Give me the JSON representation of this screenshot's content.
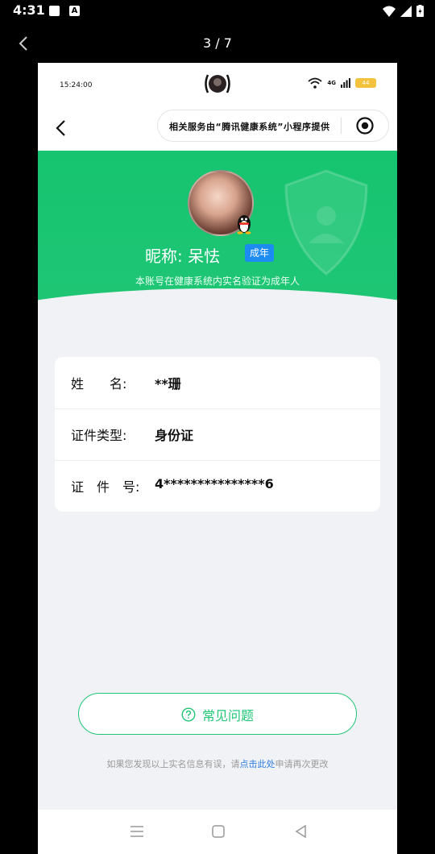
{
  "status_bar": {
    "time": "4:31",
    "icon_a": "A"
  },
  "gallery": {
    "page_counter": "3 / 7"
  },
  "inner": {
    "time": "15:24:00",
    "network": "4G",
    "battery": "44",
    "capsule_text": "相关服务由“腾讯健康系统”小程序提供"
  },
  "profile": {
    "nickname": "昵称:  呆怯",
    "age_tag": "成年",
    "verify_note": "本账号在健康系统内实名验证为成年人"
  },
  "info": {
    "rows": [
      {
        "label": "姓　　名:",
        "value": "**珊"
      },
      {
        "label": "证件类型:",
        "value": "身份证"
      },
      {
        "label": "证　件　号:",
        "value": "4***************6"
      }
    ]
  },
  "faq": {
    "label": "常见问题"
  },
  "footer": {
    "prefix": "如果您发现以上实名信息有误，请",
    "link": "点击此处",
    "suffix": "申请再次更改"
  },
  "colors": {
    "green": "#20c676",
    "blue_tag": "#1c8bf2",
    "link": "#2f7de1"
  },
  "icons": [
    "image-icon",
    "a-icon",
    "wifi-icon",
    "signal-icon",
    "battery-icon",
    "back-chevron-icon",
    "camera-icon",
    "target-icon",
    "shield-icon",
    "qq-penguin-icon",
    "help-circle-icon",
    "menu-icon",
    "home-square-icon",
    "back-triangle-icon"
  ]
}
